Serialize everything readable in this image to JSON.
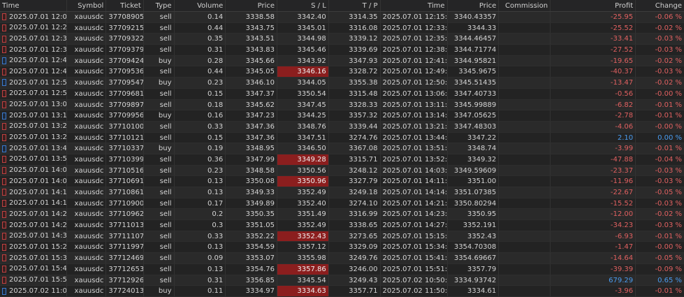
{
  "columns": {
    "time": "Time",
    "symbol": "Symbol",
    "ticket": "Ticket",
    "type": "Type",
    "volume": "Volume",
    "price": "Price",
    "sl": "S / L",
    "tp": "T / P",
    "close_time": "Time",
    "close_price": "Price",
    "commission": "Commission",
    "profit": "Profit",
    "change": "Change"
  },
  "colors": {
    "highlight_sl": "#8b1e1e",
    "negative": "#e06060",
    "positive": "#4a9cf0"
  },
  "rows": [
    {
      "time": "2025.07.01 12:03:40",
      "symbol": "xauusdc",
      "ticket": "3770890516",
      "type": "sell",
      "volume": "0.14",
      "price": "3338.58",
      "sl": "3342.40",
      "tp": "3314.35",
      "close_time": "2025.07.01 12:15:40",
      "close_price": "3340.43357",
      "commission": "",
      "profit": "-25.95",
      "change": "-0.06 %",
      "sl_hl": false,
      "sign": "neg"
    },
    {
      "time": "2025.07.01 12:26:52",
      "symbol": "xauusdc",
      "ticket": "3770921571",
      "type": "sell",
      "volume": "0.44",
      "price": "3343.75",
      "sl": "3345.01",
      "tp": "3316.08",
      "close_time": "2025.07.01 12:33:00",
      "close_price": "3344.33",
      "commission": "",
      "profit": "-25.52",
      "change": "-0.02 %",
      "sl_hl": false,
      "sign": "neg"
    },
    {
      "time": "2025.07.01 12:33:26",
      "symbol": "xauusdc",
      "ticket": "3770932254",
      "type": "sell",
      "volume": "0.35",
      "price": "3343.51",
      "sl": "3344.98",
      "tp": "3339.12",
      "close_time": "2025.07.01 12:35:00",
      "close_price": "3344.46457",
      "commission": "",
      "profit": "-33.41",
      "change": "-0.03 %",
      "sl_hl": false,
      "sign": "neg"
    },
    {
      "time": "2025.07.01 12:36:19",
      "symbol": "xauusdc",
      "ticket": "3770937906",
      "type": "sell",
      "volume": "0.31",
      "price": "3343.83",
      "sl": "3345.46",
      "tp": "3339.69",
      "close_time": "2025.07.01 12:38:27",
      "close_price": "3344.71774",
      "commission": "",
      "profit": "-27.52",
      "change": "-0.03 %",
      "sl_hl": false,
      "sign": "neg"
    },
    {
      "time": "2025.07.01 12:40:27",
      "symbol": "xauusdc",
      "ticket": "3770942425",
      "type": "buy",
      "volume": "0.28",
      "price": "3345.66",
      "sl": "3343.92",
      "tp": "3347.93",
      "close_time": "2025.07.01 12:41:37",
      "close_price": "3344.95821",
      "commission": "",
      "profit": "-19.65",
      "change": "-0.02 %",
      "sl_hl": false,
      "sign": "neg"
    },
    {
      "time": "2025.07.01 12:48:35",
      "symbol": "xauusdc",
      "ticket": "3770953697",
      "type": "sell",
      "volume": "0.44",
      "price": "3345.05",
      "sl": "3346.16",
      "tp": "3328.72",
      "close_time": "2025.07.01 12:49:58",
      "close_price": "3345.9675",
      "commission": "",
      "profit": "-40.37",
      "change": "-0.03 %",
      "sl_hl": true,
      "sign": "neg"
    },
    {
      "time": "2025.07.01 12:50:12",
      "symbol": "xauusdc",
      "ticket": "3770954772",
      "type": "buy",
      "volume": "0.23",
      "price": "3346.10",
      "sl": "3344.05",
      "tp": "3355.38",
      "close_time": "2025.07.01 12:50:49",
      "close_price": "3345.51435",
      "commission": "",
      "profit": "-13.47",
      "change": "-0.02 %",
      "sl_hl": false,
      "sign": "neg"
    },
    {
      "time": "2025.07.01 12:55:07",
      "symbol": "xauusdc",
      "ticket": "3770968113",
      "type": "sell",
      "volume": "0.15",
      "price": "3347.37",
      "sl": "3350.54",
      "tp": "3315.48",
      "close_time": "2025.07.01 13:06:16",
      "close_price": "3347.40733",
      "commission": "",
      "profit": "-0.56",
      "change": "-0.00 %",
      "sl_hl": false,
      "sign": "neg"
    },
    {
      "time": "2025.07.01 13:07:22",
      "symbol": "xauusdc",
      "ticket": "3770989793",
      "type": "sell",
      "volume": "0.18",
      "price": "3345.62",
      "sl": "3347.45",
      "tp": "3328.33",
      "close_time": "2025.07.01 13:11:18",
      "close_price": "3345.99889",
      "commission": "",
      "profit": "-6.82",
      "change": "-0.01 %",
      "sl_hl": false,
      "sign": "neg"
    },
    {
      "time": "2025.07.01 13:11:46",
      "symbol": "xauusdc",
      "ticket": "3770995625",
      "type": "buy",
      "volume": "0.16",
      "price": "3347.23",
      "sl": "3344.25",
      "tp": "3357.32",
      "close_time": "2025.07.01 13:14:49",
      "close_price": "3347.05625",
      "commission": "",
      "profit": "-2.78",
      "change": "-0.01 %",
      "sl_hl": false,
      "sign": "neg"
    },
    {
      "time": "2025.07.01 13:20:21",
      "symbol": "xauusdc",
      "ticket": "3771010059",
      "type": "sell",
      "volume": "0.33",
      "price": "3347.36",
      "sl": "3348.76",
      "tp": "3339.44",
      "close_time": "2025.07.01 13:21:38",
      "close_price": "3347.48303",
      "commission": "",
      "profit": "-4.06",
      "change": "-0.00 %",
      "sl_hl": false,
      "sign": "neg"
    },
    {
      "time": "2025.07.01 13:23:45",
      "symbol": "xauusdc",
      "ticket": "3771012102",
      "type": "sell",
      "volume": "0.15",
      "price": "3347.36",
      "sl": "3347.51",
      "tp": "3274.76",
      "close_time": "2025.07.01 13:44:35",
      "close_price": "3347.22",
      "commission": "",
      "profit": "2.10",
      "change": "0.00 %",
      "sl_hl": false,
      "sign": "pos"
    },
    {
      "time": "2025.07.01 13:48:08",
      "symbol": "xauusdc",
      "ticket": "3771033749",
      "type": "buy",
      "volume": "0.19",
      "price": "3348.95",
      "sl": "3346.50",
      "tp": "3367.08",
      "close_time": "2025.07.01 13:51:36",
      "close_price": "3348.74",
      "commission": "",
      "profit": "-3.99",
      "change": "-0.01 %",
      "sl_hl": false,
      "sign": "neg"
    },
    {
      "time": "2025.07.01 13:51:58",
      "symbol": "xauusdc",
      "ticket": "3771039924",
      "type": "sell",
      "volume": "0.36",
      "price": "3347.99",
      "sl": "3349.28",
      "tp": "3315.71",
      "close_time": "2025.07.01 13:52:31",
      "close_price": "3349.32",
      "commission": "",
      "profit": "-47.88",
      "change": "-0.04 %",
      "sl_hl": true,
      "sign": "neg"
    },
    {
      "time": "2025.07.01 14:02:12",
      "symbol": "xauusdc",
      "ticket": "3771051639",
      "type": "sell",
      "volume": "0.23",
      "price": "3348.58",
      "sl": "3350.56",
      "tp": "3248.12",
      "close_time": "2025.07.01 14:03:09",
      "close_price": "3349.59609",
      "commission": "",
      "profit": "-23.37",
      "change": "-0.03 %",
      "sl_hl": false,
      "sign": "neg"
    },
    {
      "time": "2025.07.01 14:05:53",
      "symbol": "xauusdc",
      "ticket": "3771069156",
      "type": "sell",
      "volume": "0.13",
      "price": "3350.08",
      "sl": "3350.96",
      "tp": "3327.79",
      "close_time": "2025.07.01 14:11:05",
      "close_price": "3351.00",
      "commission": "",
      "profit": "-11.96",
      "change": "-0.03 %",
      "sl_hl": true,
      "sign": "neg"
    },
    {
      "time": "2025.07.01 14:13:31",
      "symbol": "xauusdc",
      "ticket": "3771086188",
      "type": "sell",
      "volume": "0.13",
      "price": "3349.33",
      "sl": "3352.49",
      "tp": "3249.18",
      "close_time": "2025.07.01 14:14:58",
      "close_price": "3351.07385",
      "commission": "",
      "profit": "-22.67",
      "change": "-0.05 %",
      "sl_hl": false,
      "sign": "neg"
    },
    {
      "time": "2025.07.01 14:16:57",
      "symbol": "xauusdc",
      "ticket": "3771090042",
      "type": "sell",
      "volume": "0.17",
      "price": "3349.89",
      "sl": "3352.40",
      "tp": "3274.10",
      "close_time": "2025.07.01 14:21:55",
      "close_price": "3350.80294",
      "commission": "",
      "profit": "-15.52",
      "change": "-0.03 %",
      "sl_hl": false,
      "sign": "neg"
    },
    {
      "time": "2025.07.01 14:22:34",
      "symbol": "xauusdc",
      "ticket": "3771096253",
      "type": "sell",
      "volume": "0.2",
      "price": "3350.35",
      "sl": "3351.49",
      "tp": "3316.99",
      "close_time": "2025.07.01 14:23:40",
      "close_price": "3350.95",
      "commission": "",
      "profit": "-12.00",
      "change": "-0.02 %",
      "sl_hl": false,
      "sign": "neg"
    },
    {
      "time": "2025.07.01 14:25:44",
      "symbol": "xauusdc",
      "ticket": "3771101312",
      "type": "sell",
      "volume": "0.3",
      "price": "3351.05",
      "sl": "3352.49",
      "tp": "3338.65",
      "close_time": "2025.07.01 14:27:02",
      "close_price": "3352.191",
      "commission": "",
      "profit": "-34.23",
      "change": "-0.03 %",
      "sl_hl": false,
      "sign": "neg"
    },
    {
      "time": "2025.07.01 14:31:20",
      "symbol": "xauusdc",
      "ticket": "3771110756",
      "type": "sell",
      "volume": "0.33",
      "price": "3352.22",
      "sl": "3352.43",
      "tp": "3273.65",
      "close_time": "2025.07.01 15:15:56",
      "close_price": "3352.43",
      "commission": "",
      "profit": "-6.93",
      "change": "-0.01 %",
      "sl_hl": true,
      "sign": "neg"
    },
    {
      "time": "2025.07.01 15:21:45",
      "symbol": "xauusdc",
      "ticket": "3771199782",
      "type": "sell",
      "volume": "0.13",
      "price": "3354.59",
      "sl": "3357.12",
      "tp": "3329.09",
      "close_time": "2025.07.01 15:34:29",
      "close_price": "3354.70308",
      "commission": "",
      "profit": "-1.47",
      "change": "-0.00 %",
      "sl_hl": false,
      "sign": "neg"
    },
    {
      "time": "2025.07.01 15:37:48",
      "symbol": "xauusdc",
      "ticket": "3771246967",
      "type": "sell",
      "volume": "0.09",
      "price": "3353.07",
      "sl": "3355.98",
      "tp": "3249.76",
      "close_time": "2025.07.01 15:41:00",
      "close_price": "3354.69667",
      "commission": "",
      "profit": "-14.64",
      "change": "-0.05 %",
      "sl_hl": false,
      "sign": "neg"
    },
    {
      "time": "2025.07.01 15:44:10",
      "symbol": "xauusdc",
      "ticket": "3771265393",
      "type": "sell",
      "volume": "0.13",
      "price": "3354.76",
      "sl": "3357.86",
      "tp": "3246.00",
      "close_time": "2025.07.01 15:51:26",
      "close_price": "3357.79",
      "commission": "",
      "profit": "-39.39",
      "change": "-0.09 %",
      "sl_hl": true,
      "sign": "neg"
    },
    {
      "time": "2025.07.01 15:55:37",
      "symbol": "xauusdc",
      "ticket": "3771292644",
      "type": "sell",
      "volume": "0.31",
      "price": "3356.85",
      "sl": "3345.54",
      "tp": "3249.43",
      "close_time": "2025.07.02 10:50:46",
      "close_price": "3334.93742",
      "commission": "",
      "profit": "679.29",
      "change": "0.65 %",
      "sl_hl": false,
      "sign": "pos"
    },
    {
      "time": "2025.07.02 11:06:32",
      "symbol": "xauusdc",
      "ticket": "3772401384",
      "type": "buy",
      "volume": "0.11",
      "price": "3334.97",
      "sl": "3334.63",
      "tp": "3357.71",
      "close_time": "2025.07.02 11:50:53",
      "close_price": "3334.61",
      "commission": "",
      "profit": "-3.96",
      "change": "-0.01 %",
      "sl_hl": true,
      "sign": "neg"
    },
    {
      "time": "2025.07.02 14:04:52",
      "symbol": "xauusdc",
      "ticket": "3772610093",
      "type": "sell",
      "volume": "0.62",
      "price": "3346.70",
      "sl": "3346.56",
      "tp": "3324.94",
      "close_time": "2025.07.02 15:17:37",
      "close_price": "3343.07516",
      "commission": "",
      "profit": "224.74",
      "change": "0.11 %",
      "sl_hl": true,
      "sign": "pos"
    }
  ]
}
